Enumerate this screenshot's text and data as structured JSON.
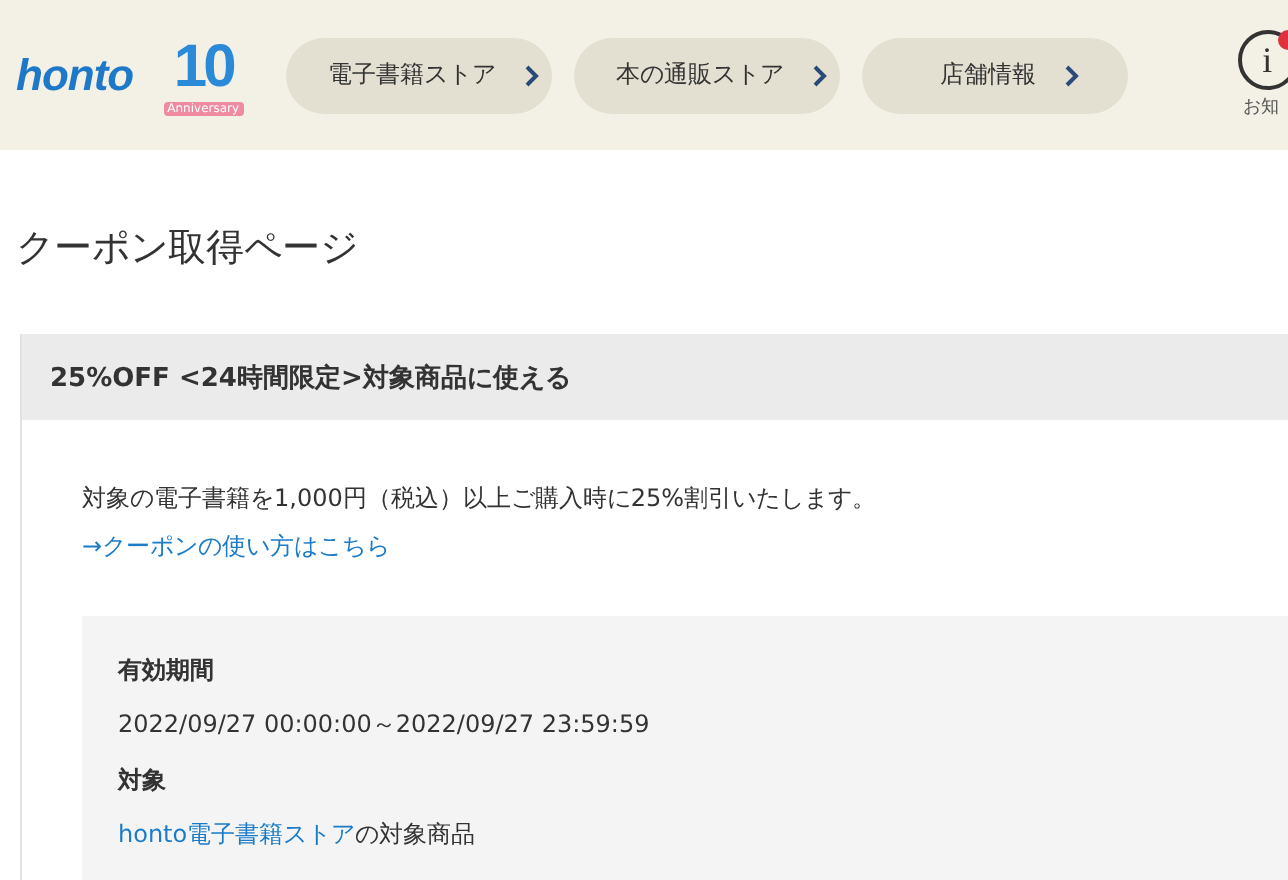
{
  "header": {
    "logo": "honto",
    "badge": {
      "number": "10",
      "caption": "Anniversary"
    },
    "nav": [
      {
        "label": "電子書籍ストア"
      },
      {
        "label": "本の通販ストア"
      },
      {
        "label": "店舗情報"
      }
    ],
    "notice": {
      "icon": "i",
      "label": "お知"
    }
  },
  "page_title": "クーポン取得ページ",
  "coupon": {
    "title": "25%OFF <24時間限定>対象商品に使える",
    "description": "対象の電子書籍を1,000円（税込）以上ご購入時に25%割引いたします。",
    "help_link": "→クーポンの使い方はこちら",
    "details": [
      {
        "label": "有効期間",
        "value": "2022/09/27 00:00:00～2022/09/27 23:59:59"
      },
      {
        "label": "対象",
        "link": "honto電子書籍ストア",
        "value": "の対象商品"
      }
    ]
  }
}
